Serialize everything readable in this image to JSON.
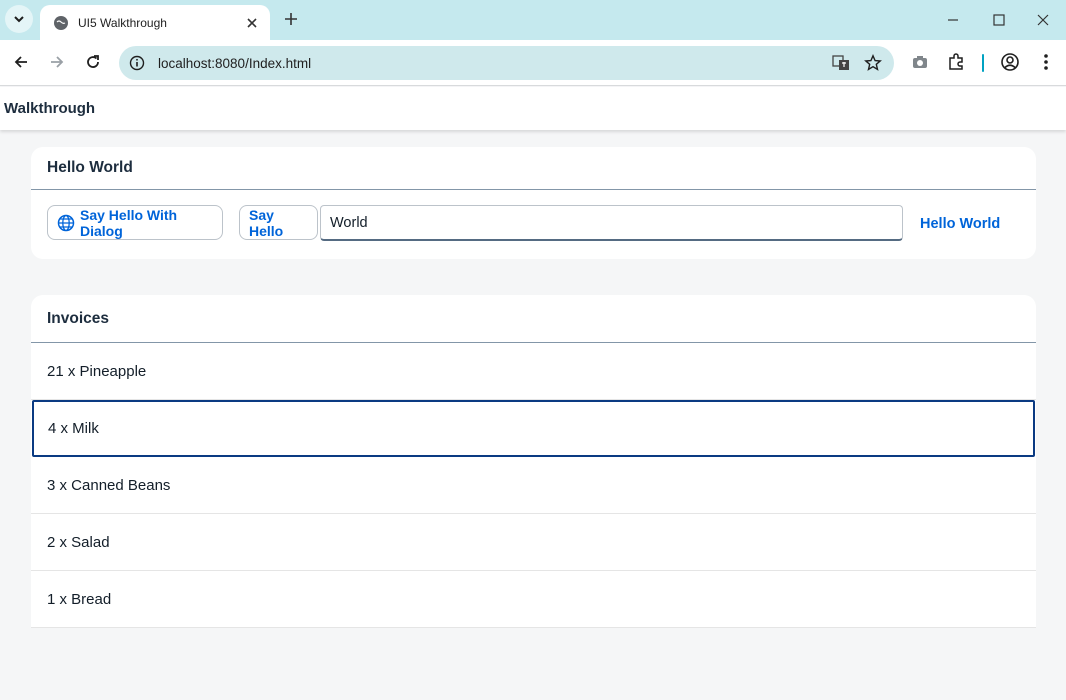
{
  "browser": {
    "tab_title": "UI5 Walkthrough",
    "url": "localhost:8080/Index.html",
    "colors": {
      "tabstrip": "#c5e9ee",
      "omnibox": "#cfe9ec"
    }
  },
  "shell": {
    "title": "Walkthrough"
  },
  "hello_panel": {
    "title": "Hello World",
    "dialog_button_label": "Say Hello With Dialog",
    "dialog_button_icon": "globe-icon",
    "hello_button_label": "Say Hello",
    "name_input_value": "World",
    "greeting_text": "Hello World"
  },
  "invoices": {
    "title": "Invoices",
    "items": [
      {
        "label": "21 x Pineapple"
      },
      {
        "label": "4 x Milk",
        "focused": true
      },
      {
        "label": "3 x Canned Beans"
      },
      {
        "label": "2 x Salad"
      },
      {
        "label": "1 x Bread"
      }
    ]
  },
  "colors": {
    "accent": "#0064d9",
    "focus": "#0a3a82",
    "background": "#f5f6f7"
  }
}
